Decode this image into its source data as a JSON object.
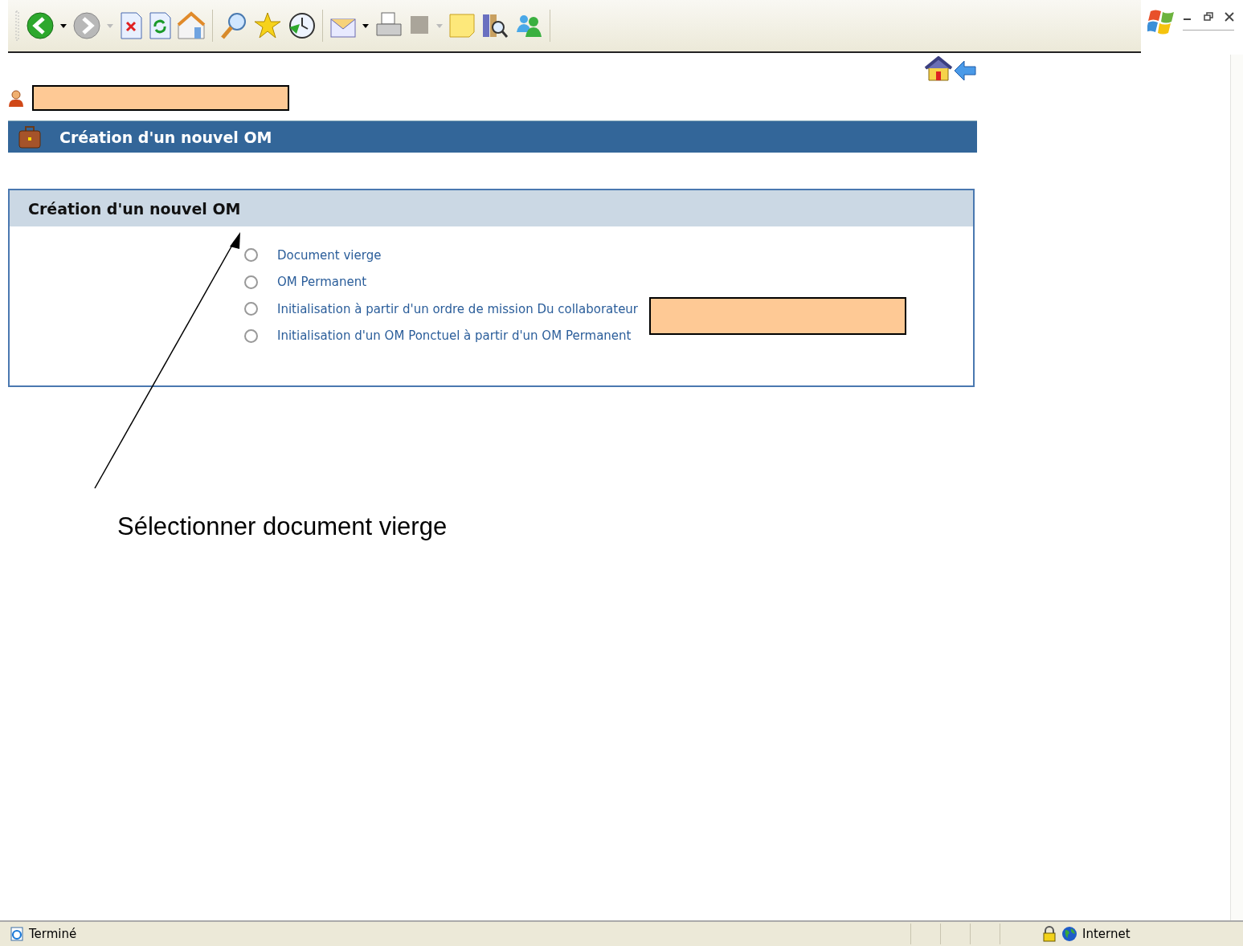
{
  "header": {
    "title": "Création d'un nouvel OM"
  },
  "panel": {
    "title": "Création d'un nouvel OM",
    "options": [
      {
        "label": "Document vierge",
        "selected": false
      },
      {
        "label": "OM Permanent",
        "selected": false
      },
      {
        "label": "Initialisation à partir d'un ordre de mission Du collaborateur",
        "selected": false
      },
      {
        "label": "Initialisation d'un OM Ponctuel à partir d'un OM Permanent",
        "selected": false
      }
    ]
  },
  "annotation": {
    "text": "Sélectionner document vierge"
  },
  "status_bar": {
    "status": "Terminé",
    "zone": "Internet"
  }
}
